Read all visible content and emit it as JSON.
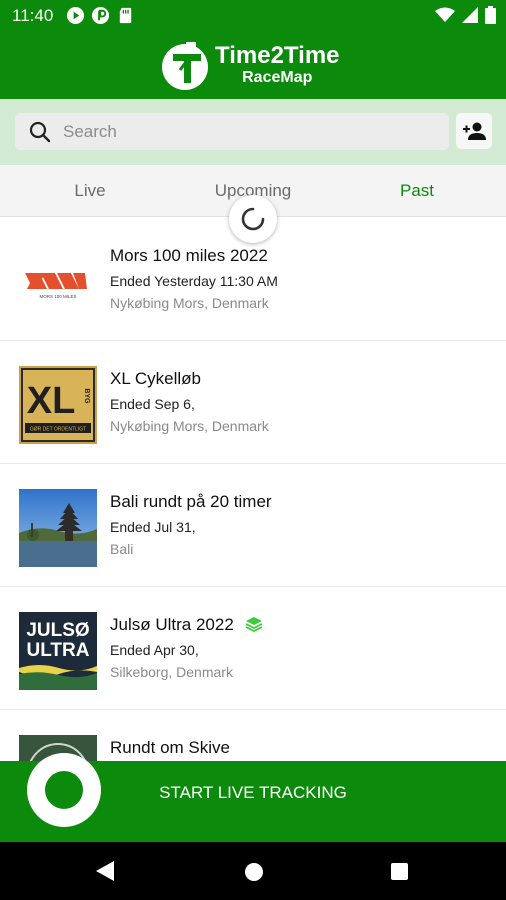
{
  "status_bar": {
    "time": "11:40"
  },
  "app_bar": {
    "logo_title": "Time2Time",
    "logo_subtitle": "RaceMap"
  },
  "search": {
    "placeholder": "Search"
  },
  "tabs": [
    {
      "label": "Live"
    },
    {
      "label": "Upcoming"
    },
    {
      "label": "Past",
      "active": true
    }
  ],
  "events": [
    {
      "name": "Mors 100 miles 2022",
      "date": "Ended Yesterday 11:30 AM",
      "location": "Nykøbing Mors, Denmark",
      "logo_caption": "MORS 100 MILES"
    },
    {
      "name": "XL Cykelløb",
      "date": "Ended Sep 6,",
      "location": "Nykøbing Mors, Denmark",
      "logo_text": "XL",
      "logo_side": "BYG",
      "logo_caption": "GØR DET ORDENTLIGT"
    },
    {
      "name": "Bali rundt på 20 timer",
      "date": "Ended Jul 31,",
      "location": "Bali"
    },
    {
      "name": "Julsø Ultra 2022",
      "date": "Ended Apr 30,",
      "location": "Silkeborg, Denmark",
      "logo_line1": "JULSØ",
      "logo_line2": "ULTRA",
      "icon": "layers-icon"
    },
    {
      "name": "Rundt om Skive",
      "date": "",
      "location": ""
    }
  ],
  "bottom_bar": {
    "start_label": "START LIVE TRACKING"
  },
  "colors": {
    "primary": "#0b8a0b",
    "light_green": "#d3ead3",
    "accent_green": "#3ec93e"
  }
}
